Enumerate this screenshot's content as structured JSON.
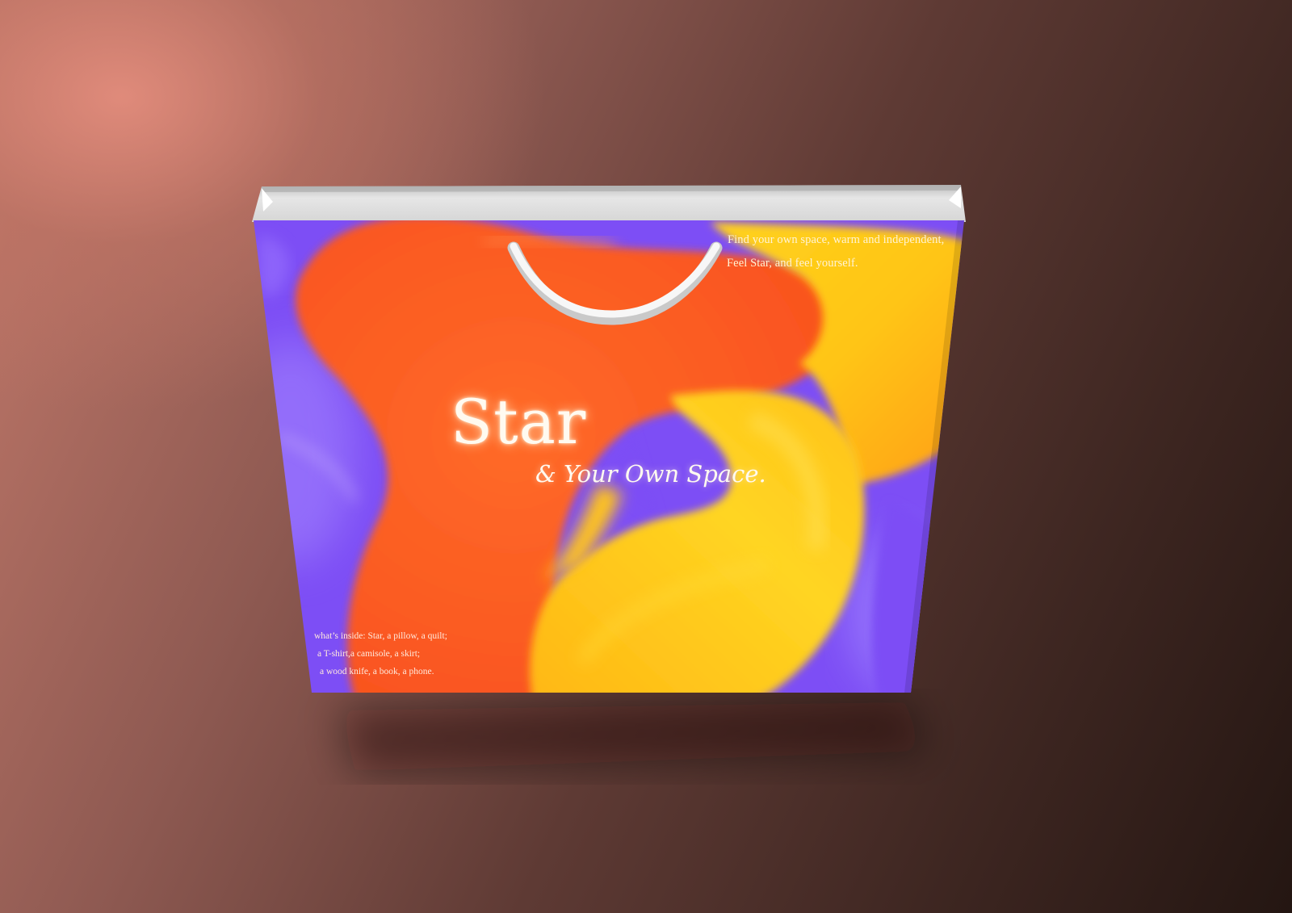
{
  "bag": {
    "tagline": [
      "Find your own space, warm and independent,",
      "Feel Star, and feel yourself."
    ],
    "brand": "Star",
    "subtitle": "& Your Own Space.",
    "inside": [
      "what’s inside: Star, a pillow, a quilt;",
      "a T-shirt,a camisole, a skirt;",
      "a wood knife, a book, a phone."
    ]
  },
  "colors": {
    "purple": "#7d4ef5",
    "orange": "#fd5f22",
    "yellow": "#ffc61a",
    "handle": "#f2f2f2"
  }
}
